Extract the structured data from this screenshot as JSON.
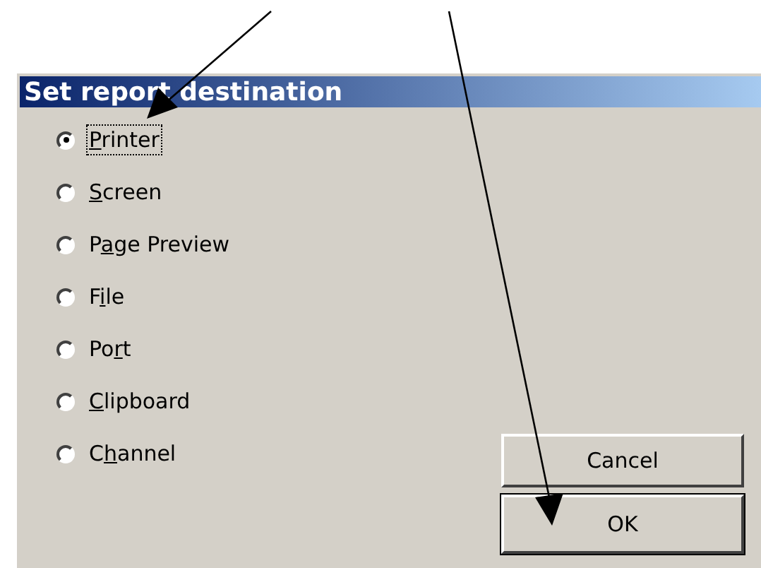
{
  "window": {
    "title": "Set report destination"
  },
  "options": [
    {
      "label_parts": [
        {
          "text": "P",
          "underlined": true
        },
        {
          "text": "rinter",
          "underlined": false
        }
      ],
      "selected": true,
      "focused": true
    },
    {
      "label_parts": [
        {
          "text": "S",
          "underlined": true
        },
        {
          "text": "creen",
          "underlined": false
        }
      ],
      "selected": false,
      "focused": false
    },
    {
      "label_parts": [
        {
          "text": "P",
          "underlined": false
        },
        {
          "text": "a",
          "underlined": true
        },
        {
          "text": "ge Preview",
          "underlined": false
        }
      ],
      "selected": false,
      "focused": false
    },
    {
      "label_parts": [
        {
          "text": "F",
          "underlined": false
        },
        {
          "text": "i",
          "underlined": true
        },
        {
          "text": "le",
          "underlined": false
        }
      ],
      "selected": false,
      "focused": false
    },
    {
      "label_parts": [
        {
          "text": "Po",
          "underlined": false
        },
        {
          "text": "r",
          "underlined": true
        },
        {
          "text": "t",
          "underlined": false
        }
      ],
      "selected": false,
      "focused": false
    },
    {
      "label_parts": [
        {
          "text": "C",
          "underlined": true
        },
        {
          "text": "lipboard",
          "underlined": false
        }
      ],
      "selected": false,
      "focused": false
    },
    {
      "label_parts": [
        {
          "text": "C",
          "underlined": false
        },
        {
          "text": "h",
          "underlined": true
        },
        {
          "text": "annel",
          "underlined": false
        }
      ],
      "selected": false,
      "focused": false
    }
  ],
  "buttons": [
    {
      "label": "Cancel",
      "default": false
    },
    {
      "label": "OK",
      "default": true
    }
  ]
}
